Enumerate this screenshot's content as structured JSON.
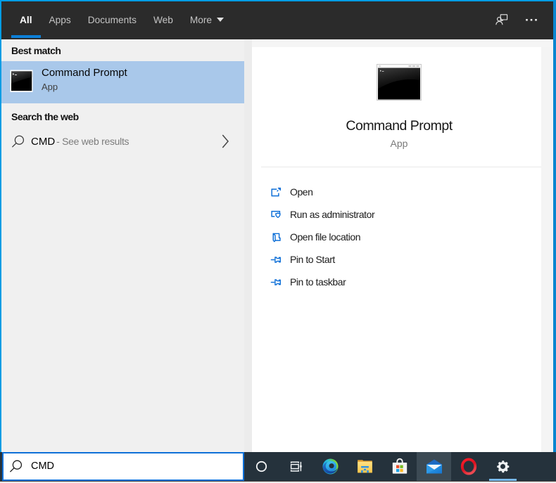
{
  "header": {
    "tabs": [
      {
        "label": "All",
        "active": true
      },
      {
        "label": "Apps",
        "active": false
      },
      {
        "label": "Documents",
        "active": false
      },
      {
        "label": "Web",
        "active": false
      },
      {
        "label": "More",
        "active": false,
        "has_caret": true
      }
    ],
    "icons": [
      "feedback-icon",
      "ellipsis-icon"
    ]
  },
  "left_panel": {
    "best_match_label": "Best match",
    "best_match": {
      "title": "Command Prompt",
      "subtitle": "App",
      "icon": "command-prompt-icon"
    },
    "web_section_label": "Search the web",
    "web_result": {
      "query": "CMD",
      "hint": "- See web results",
      "icon": "search-icon",
      "chevron": "chevron-right-icon"
    }
  },
  "right_panel": {
    "title": "Command Prompt",
    "subtitle": "App",
    "icon": "command-prompt-icon-large",
    "actions": [
      {
        "label": "Open",
        "icon": "open-icon"
      },
      {
        "label": "Run as administrator",
        "icon": "run-as-admin-icon"
      },
      {
        "label": "Open file location",
        "icon": "open-file-location-icon"
      },
      {
        "label": "Pin to Start",
        "icon": "pin-icon"
      },
      {
        "label": "Pin to taskbar",
        "icon": "pin-icon"
      }
    ]
  },
  "taskbar": {
    "search": {
      "value": "CMD",
      "icon": "search-icon"
    },
    "buttons": [
      {
        "name": "cortana"
      },
      {
        "name": "task-view"
      },
      {
        "name": "edge"
      },
      {
        "name": "file-explorer"
      },
      {
        "name": "store"
      },
      {
        "name": "mail",
        "open": true
      },
      {
        "name": "opera"
      },
      {
        "name": "settings",
        "active": true
      }
    ]
  },
  "colors": {
    "accent_border": "#009ce4",
    "searchbox_border": "#0e70d8",
    "highlight_row": "#a9c8ea",
    "header_bg": "#2b2b2b",
    "taskbar_bg": "#25323c",
    "action_icon_blue": "#0a6dd7",
    "taskbar_underline": "#76b9ed"
  }
}
